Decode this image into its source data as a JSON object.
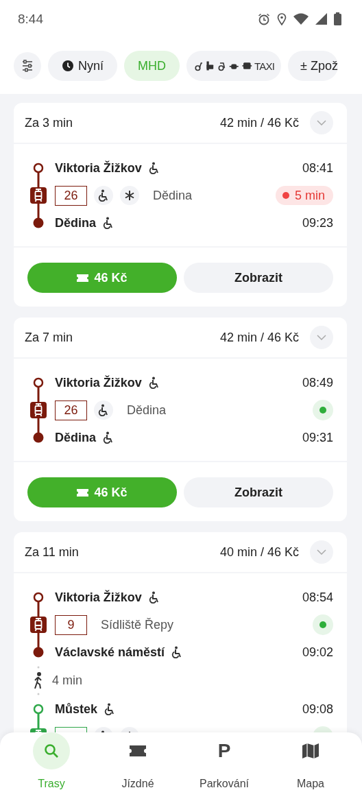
{
  "status_bar": {
    "time": "8:44"
  },
  "filters": [
    {
      "kind": "settings",
      "selected": false
    },
    {
      "kind": "time",
      "label": "Nyní",
      "selected": false
    },
    {
      "kind": "text",
      "label": "MHD",
      "selected": true
    },
    {
      "kind": "modes",
      "label": "TAXI",
      "selected": false
    },
    {
      "kind": "text",
      "label": "± Zpož",
      "selected": false
    }
  ],
  "connections": [
    {
      "departure": "Za 3 min",
      "summary": "42 min / 46 Kč",
      "price": "46 Kč",
      "details_label": "Zobrazit",
      "legs": [
        {
          "kind": "board",
          "name": "Viktoria Žižkov",
          "accessible": true,
          "time": "08:41",
          "color": "#7b1a0c"
        },
        {
          "kind": "line",
          "number": "26",
          "accessible": true,
          "air_conditioned": true,
          "direction": "Dědina",
          "delayed": true,
          "delay": "5 min",
          "color": "#7b1a0c"
        },
        {
          "kind": "alight",
          "name": "Dědina",
          "accessible": true,
          "time": "09:23",
          "color": "#7b1a0c"
        }
      ]
    },
    {
      "departure": "Za 7 min",
      "summary": "42 min / 46 Kč",
      "price": "46 Kč",
      "details_label": "Zobrazit",
      "legs": [
        {
          "kind": "board",
          "name": "Viktoria Žižkov",
          "accessible": true,
          "time": "08:49",
          "color": "#7b1a0c"
        },
        {
          "kind": "line",
          "number": "26",
          "accessible": true,
          "air_conditioned": false,
          "direction": "Dědina",
          "delayed": false,
          "color": "#7b1a0c"
        },
        {
          "kind": "alight",
          "name": "Dědina",
          "accessible": true,
          "time": "09:31",
          "color": "#7b1a0c"
        }
      ]
    },
    {
      "departure": "Za 11 min",
      "summary": "40 min / 46 Kč",
      "legs": [
        {
          "kind": "board",
          "name": "Viktoria Žižkov",
          "accessible": true,
          "time": "08:54",
          "color": "#7b1a0c"
        },
        {
          "kind": "line",
          "number": "9",
          "accessible": false,
          "air_conditioned": false,
          "direction": "Sídliště Řepy",
          "delayed": false,
          "color": "#7b1a0c"
        },
        {
          "kind": "alight",
          "name": "Václavské náměstí",
          "accessible": true,
          "time": "09:02",
          "color": "#7b1a0c"
        },
        {
          "kind": "walk",
          "duration": "4 min"
        },
        {
          "kind": "board",
          "name": "Můstek",
          "accessible": true,
          "time": "09:08",
          "color": "#2fa84a"
        },
        {
          "kind": "line",
          "accessible": true,
          "air_conditioned": true,
          "delayed": false,
          "color": "#2fa84a"
        }
      ]
    }
  ],
  "nav": [
    {
      "kind": "search",
      "label": "Trasy",
      "selected": true
    },
    {
      "kind": "ticket",
      "label": "Jízdné",
      "selected": false
    },
    {
      "kind": "parking",
      "icon": "P",
      "label": "Parkování",
      "selected": false
    },
    {
      "kind": "map",
      "label": "Mapa",
      "selected": false
    }
  ]
}
